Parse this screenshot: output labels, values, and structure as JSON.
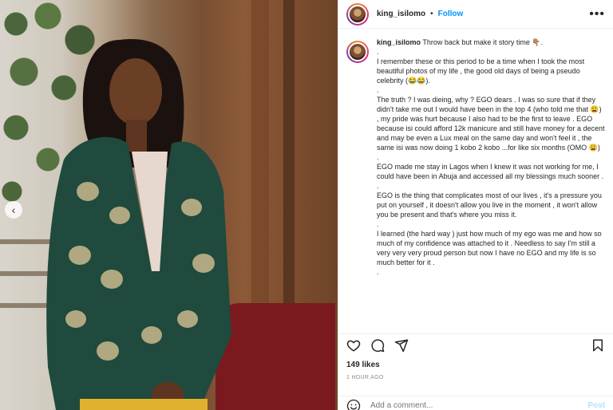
{
  "post": {
    "username": "king_isilomo",
    "follow_label": "Follow",
    "more_label": "•••",
    "caption": {
      "username": "king_isilomo",
      "first_line": "Throw back but make it story time 👇🏽.",
      "paragraphs": [
        ".",
        "I remember these or this period to be a time when I took the most beautiful photos of my life , the good old days of being a pseudo celebrity (😂😂).",
        ".",
        "The truth ? I was dieing, why ? EGO dears . I was so sure that if they didn't take me out I would have been in the top 4 (who told me that 😩) , my pride was hurt because I also had to be the first to leave . EGO because isi could afford 12k manicure and still have money for a decent and may be even a Lux meal on the same day and won't feel it , the same isi was now doing 1 kobo 2 kobo ...for like six months (OMO 😩)",
        ".",
        "EGO made me stay in Lagos when I knew it was not working for me, I could have been in Abuja and accessed all my blessings much sooner .",
        ".",
        "EGO is the thing that complicates most of our lives , it's a pressure you put on yourself , it doesn't allow you live in the moment , it won't allow you be present and that's where you miss it.",
        ".",
        "I learned (the hard way ) just how much of my ego was me and how so much of my confidence was attached to it . Needless to say I'm still a very very very proud person but now I have no EGO and my life is so much better for it .",
        "."
      ]
    },
    "likes": "149 likes",
    "timestamp": "1 HOUR AGO",
    "comment_placeholder": "Add a comment...",
    "post_label": "Post"
  },
  "icons": {
    "like": "heart-icon",
    "comment": "comment-icon",
    "share": "share-icon",
    "save": "bookmark-icon",
    "emoji": "emoji-icon",
    "prev": "chevron-left-icon"
  },
  "colors": {
    "link_blue": "#0095f6",
    "muted_text": "#8e8e8e",
    "post_disabled": "#b2dffc",
    "border": "#efefef"
  }
}
